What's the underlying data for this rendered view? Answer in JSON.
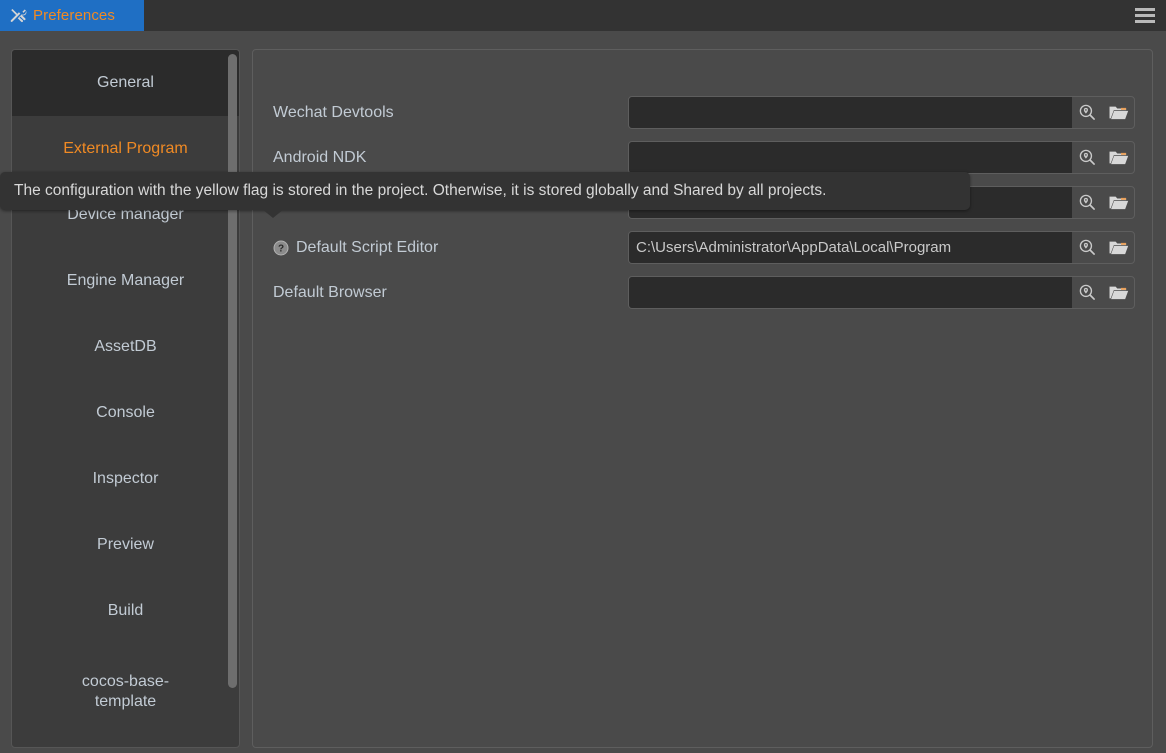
{
  "window": {
    "tab_label": "Preferences",
    "tab_icon": "tools-icon",
    "menu_icon": "hamburger-menu-icon"
  },
  "sidebar": {
    "items": [
      {
        "label": "General",
        "state": "hover"
      },
      {
        "label": "External Program",
        "state": "active"
      },
      {
        "label": "Device manager",
        "state": "normal"
      },
      {
        "label": "Engine Manager",
        "state": "normal"
      },
      {
        "label": "AssetDB",
        "state": "normal"
      },
      {
        "label": "Console",
        "state": "normal"
      },
      {
        "label": "Inspector",
        "state": "normal"
      },
      {
        "label": "Preview",
        "state": "normal"
      },
      {
        "label": "Build",
        "state": "normal"
      },
      {
        "label": "cocos-base-\ntemplate",
        "state": "normal"
      }
    ],
    "scrollbar": "vertical-scrollbar"
  },
  "main": {
    "rows": [
      {
        "label": "Wechat Devtools",
        "value": "",
        "placeholder": "",
        "has_help": false,
        "locate_icon": "magnifier-locate-icon",
        "browse_icon": "open-folder-icon"
      },
      {
        "label": "Android NDK",
        "value": "",
        "placeholder": "",
        "has_help": false,
        "locate_icon": "magnifier-locate-icon",
        "browse_icon": "open-folder-icon"
      },
      {
        "label": "",
        "value": "",
        "placeholder": "",
        "has_help": false,
        "locate_icon": "magnifier-locate-icon",
        "browse_icon": "open-folder-icon"
      },
      {
        "label": "Default Script Editor",
        "value": "C:\\Users\\Administrator\\AppData\\Local\\Program",
        "placeholder": "",
        "has_help": true,
        "help_icon": "question-mark-help-icon",
        "locate_icon": "magnifier-locate-icon",
        "browse_icon": "open-folder-icon"
      },
      {
        "label": "Default Browser",
        "value": "",
        "placeholder": "",
        "has_help": false,
        "locate_icon": "magnifier-locate-icon",
        "browse_icon": "open-folder-icon"
      }
    ]
  },
  "tooltip": {
    "text": "The configuration with the yellow flag is stored in the project. Otherwise, it is stored globally and Shared by all projects."
  },
  "colors": {
    "tab_accent": "#1f6fc4",
    "tab_text": "#f08a24",
    "active_item": "#f08a24",
    "label_text": "#c2cbd4",
    "panel_bg": "#4a4a4a",
    "sidebar_bg": "#3c3c3c",
    "input_bg": "#2b2b2b",
    "tooltip_bg": "#333333"
  }
}
